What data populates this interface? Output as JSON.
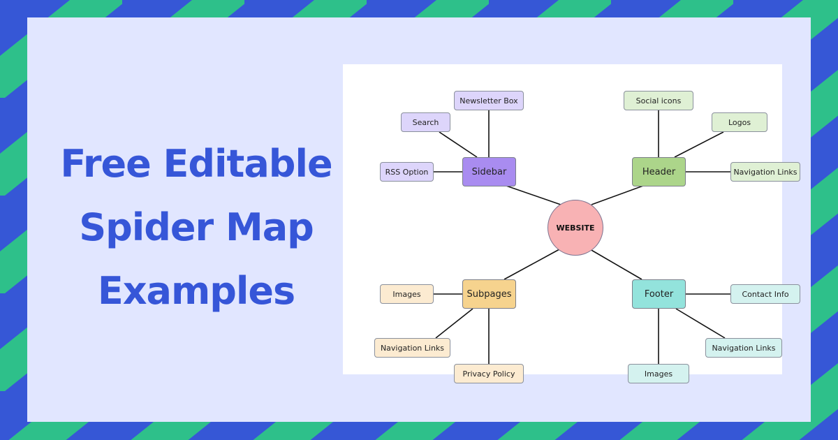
{
  "title": {
    "lines": [
      "Free Editable",
      "Spider Map",
      "Examples"
    ]
  },
  "colors": {
    "stripe_blue": "#3657d6",
    "stripe_green": "#2ec08a",
    "panel_bg": "#e1e6ff",
    "title_text": "#3656d8",
    "center_fill": "#f8b2b4",
    "sidebar_hub": "#a98cf0",
    "sidebar_leaf": "#ddd5fb",
    "header_hub": "#acd58a",
    "header_leaf": "#dff0d4",
    "subpages_hub": "#f6d38e",
    "subpages_leaf": "#fcebd1",
    "footer_hub": "#93e3dc",
    "footer_leaf": "#d4f2ef",
    "connector": "#111111"
  },
  "diagram": {
    "center": {
      "label": "WEBSITE"
    },
    "branches": [
      {
        "key": "sidebar",
        "label": "Sidebar",
        "leaves": [
          "Newsletter Box",
          "Search",
          "RSS Option"
        ]
      },
      {
        "key": "header",
        "label": "Header",
        "leaves": [
          "Social icons",
          "Logos",
          "Navigation Links"
        ]
      },
      {
        "key": "subpages",
        "label": "Subpages",
        "leaves": [
          "Images",
          "Navigation Links",
          "Privacy Policy"
        ]
      },
      {
        "key": "footer",
        "label": "Footer",
        "leaves": [
          "Contact Info",
          "Navigation Links",
          "Images"
        ]
      }
    ]
  }
}
